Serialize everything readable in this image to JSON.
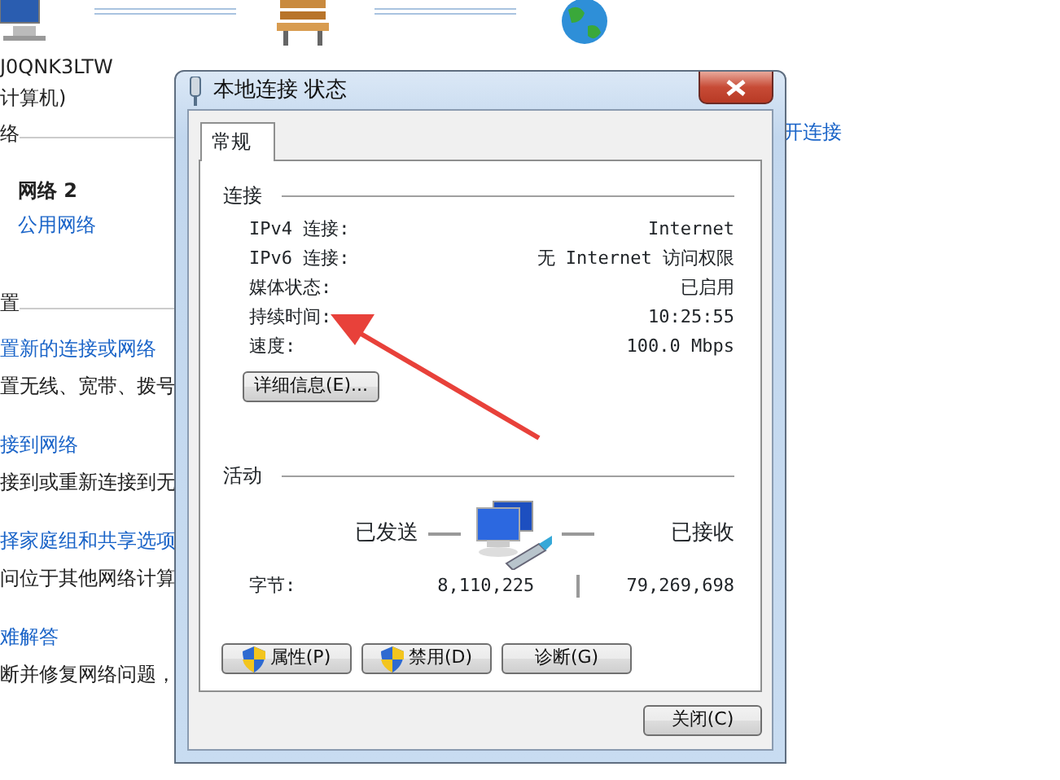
{
  "background": {
    "devices": [
      {
        "label": "J0QNK3LTW",
        "sublabel": "计算机)"
      }
    ],
    "section_label": "络",
    "disconnect_link": "开连接",
    "network": {
      "name": "网络  2",
      "type": "公用网络"
    },
    "settings_heading": "置",
    "tasks": [
      {
        "title": "置新的连接或网络",
        "description": "置无线、宽带、拨号"
      },
      {
        "title": "接到网络",
        "description": "接到或重新连接到无"
      },
      {
        "title": "择家庭组和共享选项",
        "description": "问位于其他网络计算"
      },
      {
        "title": "难解答",
        "description": "断并修复网络问题，"
      }
    ]
  },
  "dialog": {
    "title": "本地连接 状态",
    "tabs": [
      {
        "label": "常规",
        "selected": true
      }
    ],
    "connection": {
      "heading": "连接",
      "rows": [
        {
          "label": "IPv4 连接:",
          "value": "Internet"
        },
        {
          "label": "IPv6 连接:",
          "value": "无 Internet 访问权限"
        },
        {
          "label": "媒体状态:",
          "value": "已启用"
        },
        {
          "label": "持续时间:",
          "value": "10:25:55"
        },
        {
          "label": "速度:",
          "value": "100.0 Mbps"
        }
      ],
      "details_button": "详细信息(E)..."
    },
    "activity": {
      "heading": "活动",
      "sent_label": "已发送",
      "received_label": "已接收",
      "bytes_label": "字节:",
      "sent": "8,110,225",
      "received": "79,269,698"
    },
    "buttons": [
      {
        "label": "属性(P)",
        "shield": true
      },
      {
        "label": "禁用(D)",
        "shield": true
      },
      {
        "label": "诊断(G)",
        "shield": false
      }
    ],
    "close_button": "关闭(C)"
  }
}
